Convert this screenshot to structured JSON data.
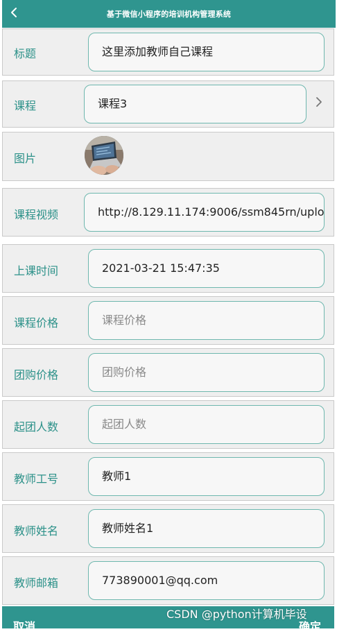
{
  "navbar": {
    "back_icon": "chevron-left-icon",
    "title": "基于微信小程序的培训机构管理系统"
  },
  "form": {
    "title": {
      "label": "标题",
      "value": "这里添加教师自己课程"
    },
    "course": {
      "label": "课程",
      "value": "课程3",
      "chevron_icon": "chevron-right-icon"
    },
    "image": {
      "label": "图片",
      "avatar_icon": "laptop-photo-icon"
    },
    "video": {
      "label": "课程视频",
      "value": "http://8.129.11.174:9006/ssm845rn/uplo"
    },
    "class_time": {
      "label": "上课时间",
      "value": "2021-03-21 15:47:35"
    },
    "price": {
      "label": "课程价格",
      "placeholder": "课程价格"
    },
    "group_price": {
      "label": "团购价格",
      "placeholder": "团购价格"
    },
    "min_group": {
      "label": "起团人数",
      "placeholder": "起团人数"
    },
    "teacher_id": {
      "label": "教师工号",
      "value": "教师1"
    },
    "teacher_name": {
      "label": "教师姓名",
      "value": "教师姓名1"
    },
    "teacher_email": {
      "label": "教师邮箱",
      "value": "773890001@qq.com"
    }
  },
  "footer": {
    "cancel_label": "取消",
    "confirm_label": "确定"
  },
  "watermark": "CSDN @python计算机毕设",
  "colors": {
    "primary": "#2f958f",
    "label": "#2c9189",
    "row_bg": "#efefef",
    "field_border": "#6eb7ae"
  }
}
